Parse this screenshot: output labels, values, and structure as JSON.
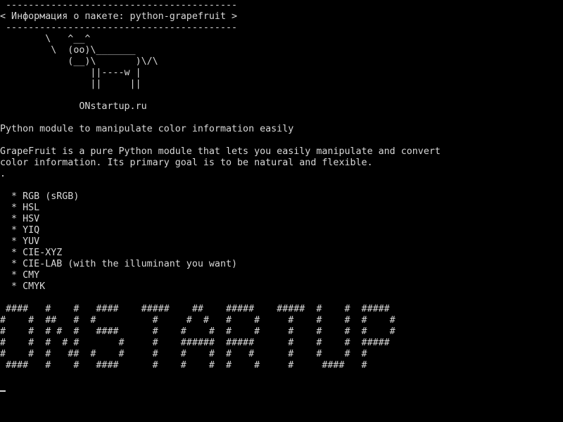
{
  "terminal": {
    "colors": {
      "background": "#000000",
      "foreground": "#d8d8d8"
    },
    "lines": [
      " -----------------------------------------",
      "< Информация о пакете: python-grapefruit >",
      " -----------------------------------------",
      "        \\   ^__^",
      "         \\  (oo)\\_______",
      "            (__)\\       )\\/\\",
      "                ||----w |",
      "                ||     ||",
      "",
      "              ONstartup.ru",
      "",
      "Python module to manipulate color information easily",
      "",
      "GrapeFruit is a pure Python module that lets you easily manipulate and convert",
      "color information. Its primary goal is to be natural and flexible.",
      ".",
      "",
      "  * RGB (sRGB)",
      "  * HSL",
      "  * HSV",
      "  * YIQ",
      "  * YUV",
      "  * CIE-XYZ",
      "  * CIE-LAB (with the illuminant you want)",
      "  * CMY",
      "  * CMYK",
      "",
      " ####   #    #   ####    #####    ##    #####    #####  #    #  #####",
      "#    #  ##   #  #          #     #  #   #    #     #    #    #  #    #",
      "#    #  # #  #   ####      #    #    #  #    #     #    #    #  #    #",
      "#    #  #  # #       #     #    ######  #####      #    #    #  #####",
      "#    #  #   ##  #    #     #    #    #  #   #      #    #    #  #",
      " ####   #    #   ####      #    #    #  #    #     #     ####   #"
    ]
  }
}
